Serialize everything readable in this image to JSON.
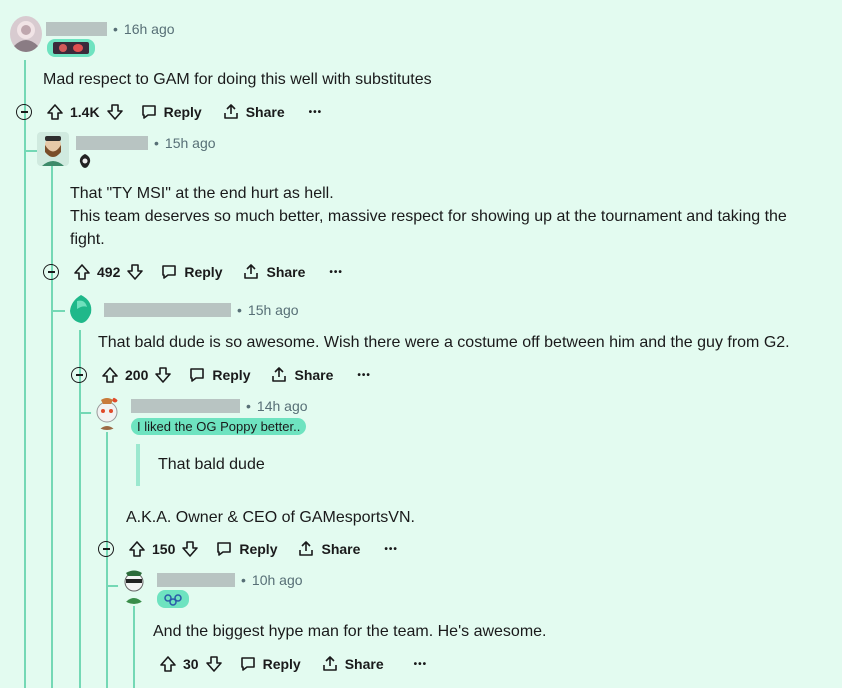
{
  "comments": [
    {
      "time": "16h ago",
      "body": "Mad respect to GAM for doing this well with substitutes",
      "votes": "1.4K",
      "reply": "Reply",
      "share": "Share",
      "more": "•••"
    },
    {
      "time": "15h ago",
      "body_line1": "That \"TY MSI\" at the end hurt as hell.",
      "body_line2": "This team deserves so much better, massive respect for showing up at the tournament and taking the fight.",
      "votes": "492",
      "reply": "Reply",
      "share": "Share",
      "more": "•••"
    },
    {
      "time": "15h ago",
      "body": "That bald dude is so awesome. Wish there were a costume off between him and the guy from G2.",
      "votes": "200",
      "reply": "Reply",
      "share": "Share",
      "more": "•••"
    },
    {
      "time": "14h ago",
      "flair": "I liked the OG Poppy better..",
      "quote": "That bald dude",
      "body": "A.K.A. Owner & CEO of GAMesportsVN.",
      "votes": "150",
      "reply": "Reply",
      "share": "Share",
      "more": "•••"
    },
    {
      "time": "10h ago",
      "body": "And the biggest hype man for the team. He's awesome.",
      "votes": "30",
      "reply": "Reply",
      "share": "Share",
      "more": "•••"
    }
  ],
  "separator": "•",
  "colors": {
    "background": "#e3fbf0",
    "thread": "#74d8b5",
    "flair": "#6ee3c0"
  }
}
